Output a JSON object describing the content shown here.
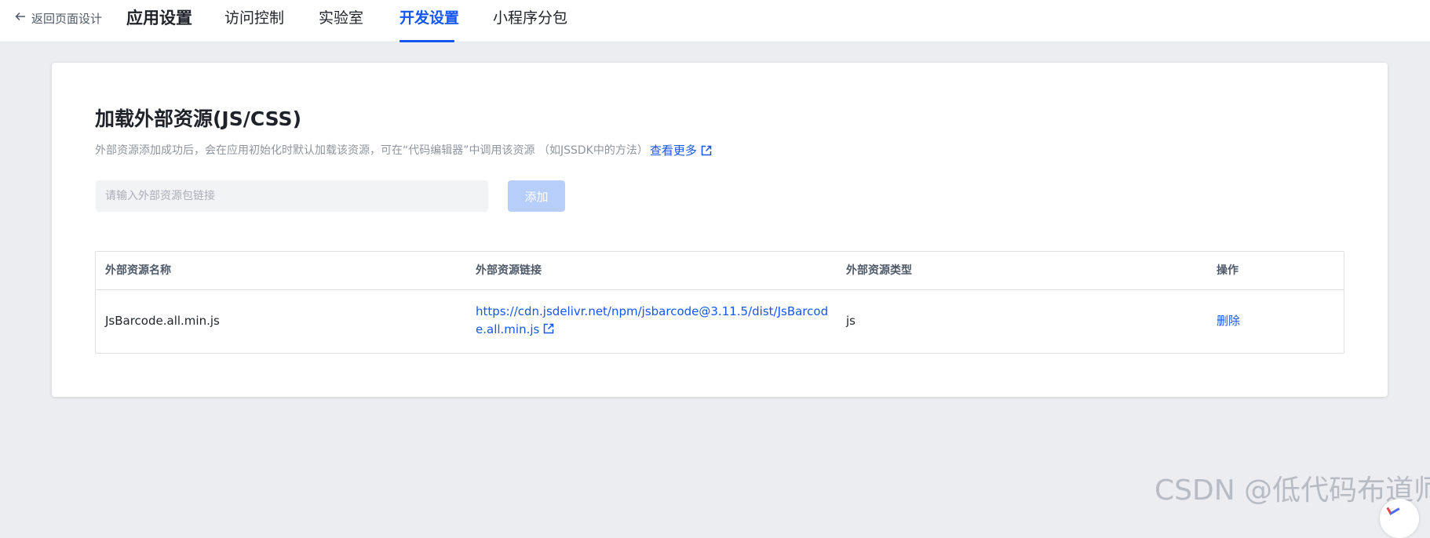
{
  "header": {
    "back_label": "返回页面设计",
    "app_title": "应用设置",
    "tabs": [
      {
        "label": "访问控制"
      },
      {
        "label": "实验室"
      },
      {
        "label": "开发设置",
        "active": true
      },
      {
        "label": "小程序分包"
      }
    ]
  },
  "section": {
    "title": "加载外部资源(JS/CSS)",
    "description": "外部资源添加成功后，会在应用初始化时默认加载该资源，可在“代码编辑器”中调用该资源 （如JSSDK中的方法）",
    "see_more": "查看更多",
    "input_placeholder": "请输入外部资源包链接",
    "input_value": "",
    "add_button": "添加"
  },
  "table": {
    "columns": [
      "外部资源名称",
      "外部资源链接",
      "外部资源类型",
      "操作"
    ],
    "rows": [
      {
        "name": "JsBarcode.all.min.js",
        "url": "https://cdn.jsdelivr.net/npm/jsbarcode@3.11.5/dist/JsBarcode.all.min.js",
        "type": "js",
        "action": "删除"
      }
    ]
  },
  "watermark": "CSDN @低代码布道师",
  "colors": {
    "accent": "#1456f0",
    "background": "#ebedf1",
    "disabled_button": "#b7cefb"
  }
}
